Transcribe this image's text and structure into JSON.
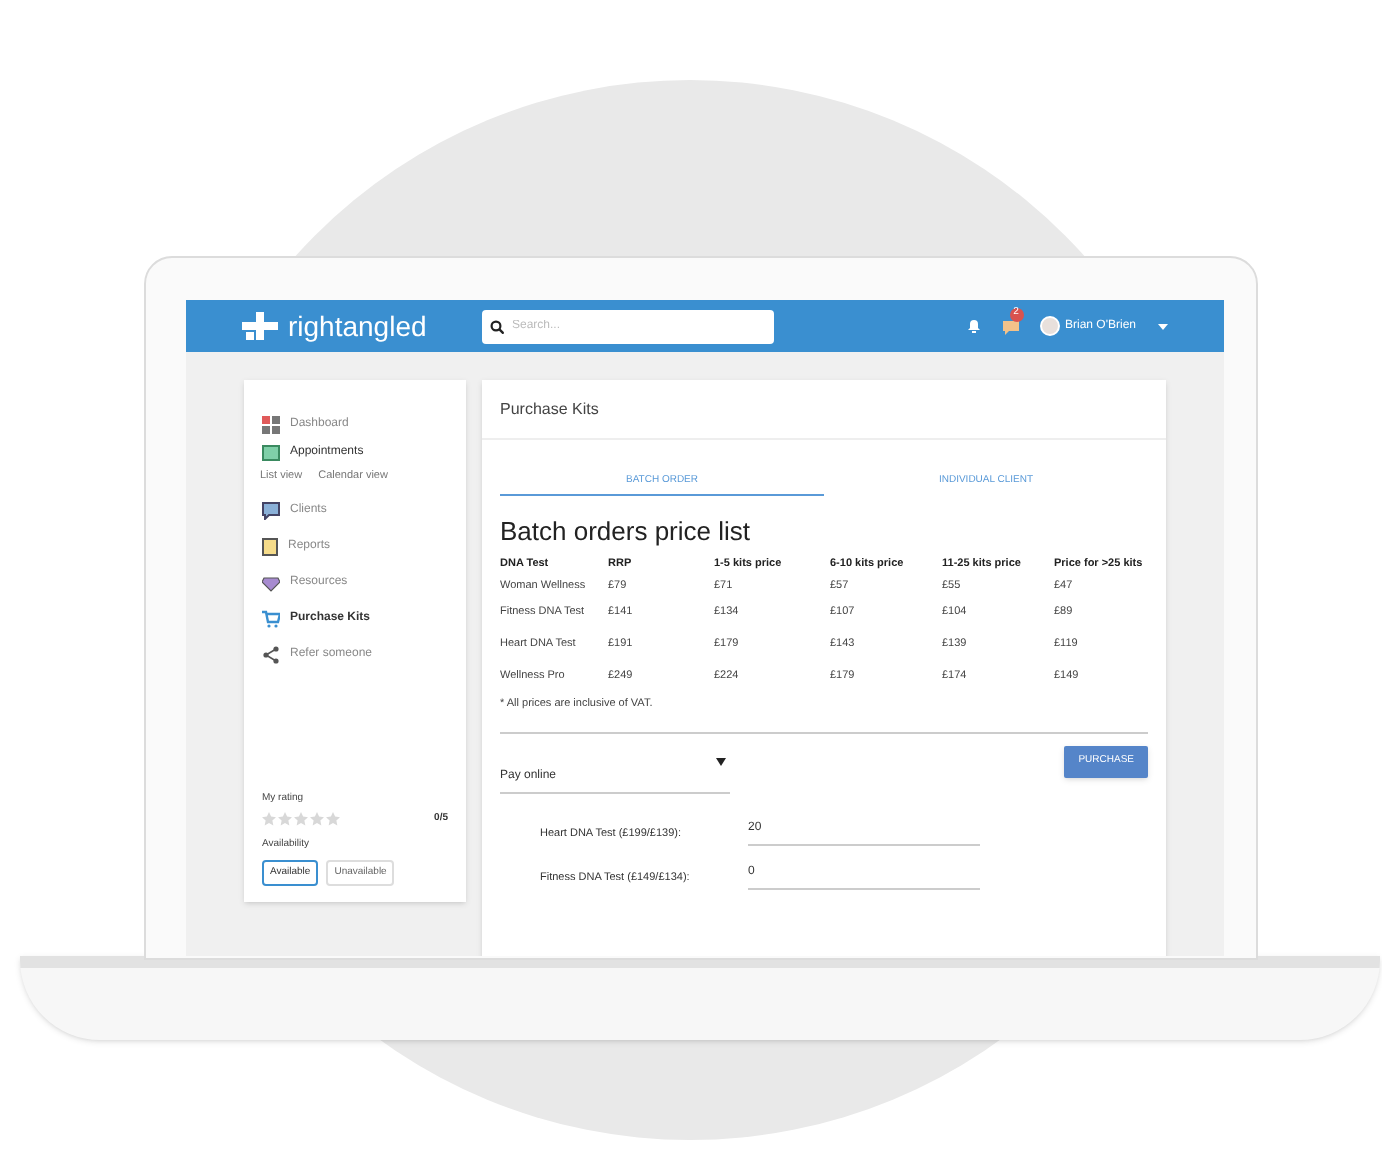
{
  "header": {
    "logo": "rightangled",
    "search_placeholder": "Search...",
    "message_count": "2",
    "user": "Brian O'Brien"
  },
  "sidebar": {
    "items": [
      {
        "label": "Dashboard",
        "selected": false,
        "expanded": false
      },
      {
        "label": "Appointments",
        "selected": false,
        "expanded": true,
        "links": [
          "List view",
          "Calendar view"
        ]
      },
      {
        "label": "Clients",
        "selected": false,
        "expanded": false
      },
      {
        "label": "Reports",
        "selected": false,
        "expanded": false
      },
      {
        "label": "Resources",
        "selected": false,
        "expanded": false
      },
      {
        "label": "Purchase Kits",
        "selected": true,
        "expanded": false
      },
      {
        "label": "Refer someone",
        "selected": false,
        "expanded": false
      }
    ],
    "rating": {
      "label": "My rating",
      "stars": 0,
      "score": "0/5"
    },
    "availability": {
      "label": "Availability",
      "options": [
        {
          "label": "Available",
          "selected": true
        },
        {
          "label": "Unavailable",
          "selected": false
        }
      ]
    }
  },
  "main": {
    "title": "Purchase Kits",
    "tabs": [
      {
        "label": "BATCH ORDER",
        "selected": true
      },
      {
        "label": "INDIVIDUAL CLIENT",
        "selected": false
      }
    ],
    "heading": "Batch orders price list",
    "table": {
      "columns": [
        "DNA Test",
        "RRP",
        "1-5 kits price",
        "6-10 kits price",
        "11-25 kits price",
        "Price for >25 kits"
      ],
      "rows": [
        [
          "Woman Wellness",
          "£79",
          "£71",
          "£57",
          "£55",
          "£47"
        ],
        [
          "Fitness DNA Test",
          "£141",
          "£134",
          "£107",
          "£104",
          "£89"
        ],
        [
          "Heart DNA Test",
          "£191",
          "£179",
          "£143",
          "£139",
          "£119"
        ],
        [
          "Wellness Pro",
          "£249",
          "£224",
          "£179",
          "£174",
          "£149"
        ]
      ]
    },
    "note": "* All prices are inclusive of VAT.",
    "payment": {
      "value": "Pay online"
    },
    "purchase_button": "PURCHASE",
    "quantities": [
      {
        "label": "Heart DNA Test (£199/£139):",
        "value": "20"
      },
      {
        "label": "Fitness DNA Test (£149/£134):",
        "value": "0"
      }
    ]
  }
}
